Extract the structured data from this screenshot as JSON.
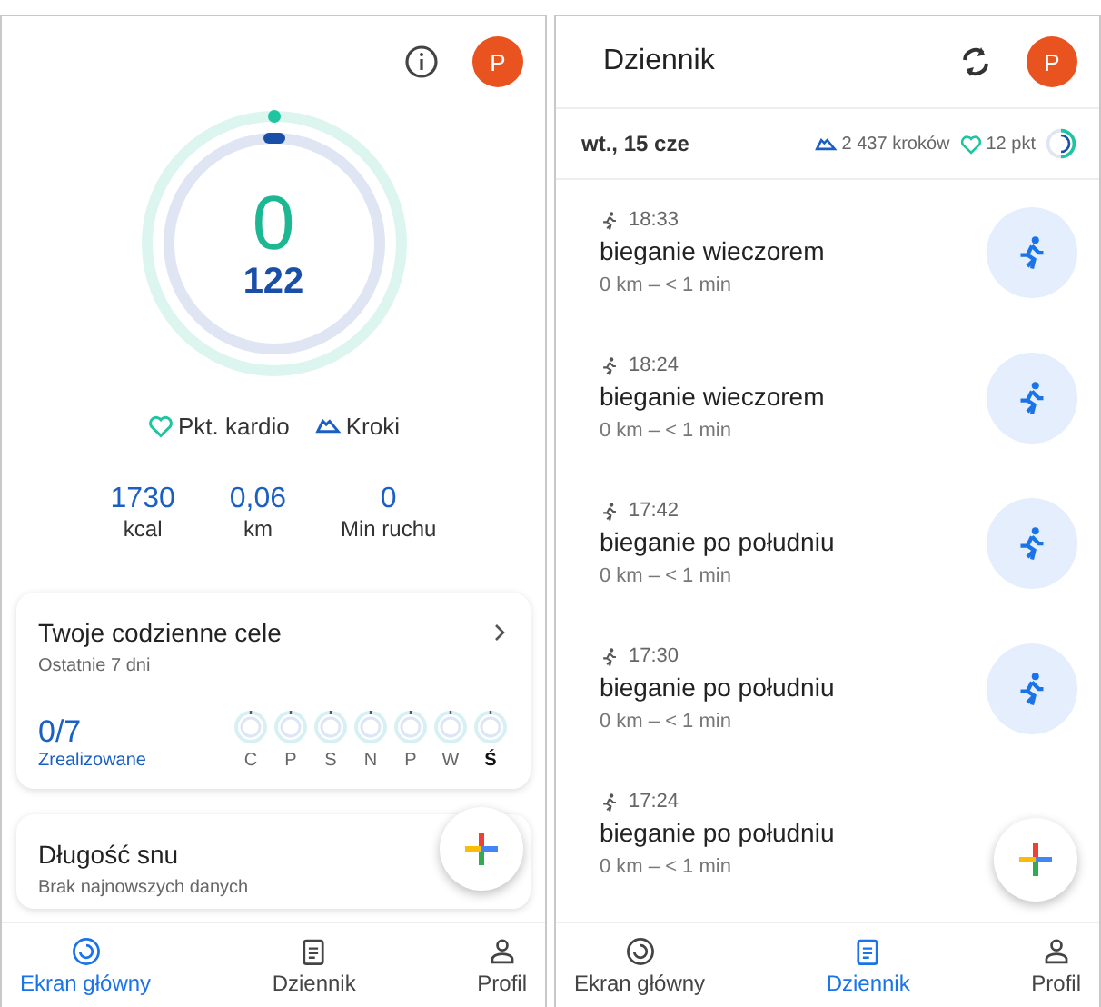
{
  "home": {
    "avatar": "P",
    "ring": {
      "main": "0",
      "secondary": "122"
    },
    "legend": [
      {
        "kind": "heart",
        "label": "Pkt. kardio"
      },
      {
        "kind": "steps",
        "label": "Kroki"
      }
    ],
    "stats": [
      {
        "value": "1730",
        "label": "kcal"
      },
      {
        "value": "0,06",
        "label": "km"
      },
      {
        "value": "0",
        "label": "Min ruchu"
      }
    ],
    "goals_card": {
      "title": "Twoje codzienne cele",
      "subtitle": "Ostatnie 7 dni",
      "count": "0/7",
      "count_label": "Zrealizowane",
      "days": [
        {
          "label": "C",
          "selected": false
        },
        {
          "label": "P",
          "selected": false
        },
        {
          "label": "S",
          "selected": false
        },
        {
          "label": "N",
          "selected": false
        },
        {
          "label": "P",
          "selected": false
        },
        {
          "label": "W",
          "selected": false
        },
        {
          "label": "Ś",
          "selected": true
        }
      ]
    },
    "sleep_card": {
      "title": "Długość snu",
      "subtitle": "Brak najnowszych danych"
    },
    "nav": [
      {
        "kind": "home",
        "label": "Ekran główny",
        "selected": true
      },
      {
        "kind": "journal",
        "label": "Dziennik",
        "selected": false
      },
      {
        "kind": "profile",
        "label": "Profil",
        "selected": false
      }
    ]
  },
  "journal": {
    "title": "Dziennik",
    "avatar": "P",
    "date": "wt., 15 cze",
    "steps": "2 437 kroków",
    "points": "12 pkt",
    "entries": [
      {
        "time": "18:33",
        "title": "bieganie wieczorem",
        "detail": "0 km – < 1 min"
      },
      {
        "time": "18:24",
        "title": "bieganie wieczorem",
        "detail": "0 km – < 1 min"
      },
      {
        "time": "17:42",
        "title": "bieganie po południu",
        "detail": "0 km – < 1 min"
      },
      {
        "time": "17:30",
        "title": "bieganie po południu",
        "detail": "0 km – < 1 min"
      },
      {
        "time": "17:24",
        "title": "bieganie po południu",
        "detail": "0 km – < 1 min"
      }
    ],
    "nav": [
      {
        "kind": "home",
        "label": "Ekran główny",
        "selected": false
      },
      {
        "kind": "journal",
        "label": "Dziennik",
        "selected": true
      },
      {
        "kind": "profile",
        "label": "Profil",
        "selected": false
      }
    ]
  }
}
